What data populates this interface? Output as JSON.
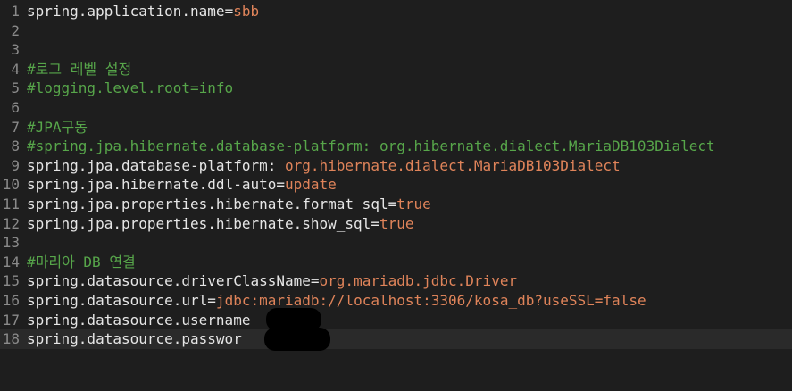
{
  "lines": [
    {
      "num": "1",
      "key": "spring.application.name",
      "eq": "=",
      "val": "sbb"
    },
    {
      "num": "2"
    },
    {
      "num": "3"
    },
    {
      "num": "4",
      "comment": "#로그 레벨 설정"
    },
    {
      "num": "5",
      "comment": "#logging.level.root=info"
    },
    {
      "num": "6"
    },
    {
      "num": "7",
      "comment": "#JPA구동"
    },
    {
      "num": "8",
      "comment": "#spring.jpa.hibernate.database-platform: org.hibernate.dialect.MariaDB103Dialect"
    },
    {
      "num": "9",
      "key": "spring.jpa.database-platform",
      "eq": ": ",
      "val": "org.hibernate.dialect.MariaDB103Dialect"
    },
    {
      "num": "10",
      "key": "spring.jpa.hibernate.ddl-auto",
      "eq": "=",
      "val": "update"
    },
    {
      "num": "11",
      "key": "spring.jpa.properties.hibernate.format_sql",
      "eq": "=",
      "val": "true"
    },
    {
      "num": "12",
      "key": "spring.jpa.properties.hibernate.show_sql",
      "eq": "=",
      "val": "true"
    },
    {
      "num": "13"
    },
    {
      "num": "14",
      "comment": "#마리아 DB 연결"
    },
    {
      "num": "15",
      "key": "spring.datasource.driverClassName",
      "eq": "=",
      "val": "org.mariadb.jdbc.Driver"
    },
    {
      "num": "16",
      "key": "spring.datasource.url",
      "eq": "=",
      "val": "jdbc:mariadb://localhost:3306/kosa_db?useSSL=false"
    },
    {
      "num": "17",
      "key": "spring.datasource.username",
      "eq": "",
      "val": ""
    },
    {
      "num": "18",
      "key": "spring.datasource.passwor",
      "eq": "",
      "val": ""
    }
  ],
  "colors": {
    "background": "#1e1e1e",
    "line_number": "#8a8a8a",
    "key": "#e6e6e6",
    "value": "#e0845a",
    "comment": "#57a64a",
    "current_line": "#2a2a2a",
    "redaction": "#000000"
  }
}
